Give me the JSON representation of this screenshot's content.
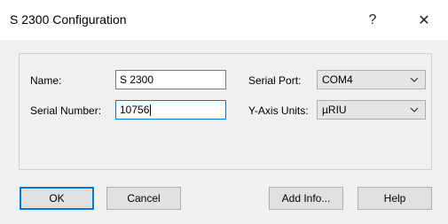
{
  "window": {
    "title": "S 2300 Configuration",
    "help_glyph": "?",
    "close_glyph": "✕"
  },
  "form": {
    "name_label": "Name:",
    "name_value": "S 2300",
    "serial_number_label": "Serial Number:",
    "serial_number_value": "10756",
    "serial_port_label": "Serial Port:",
    "serial_port_value": "COM4",
    "y_axis_units_label": "Y-Axis Units:",
    "y_axis_units_value": "µRIU"
  },
  "buttons": {
    "ok": "OK",
    "cancel": "Cancel",
    "add_info": "Add Info...",
    "help": "Help"
  },
  "colors": {
    "focus_border": "#0078d7",
    "dialog_background": "#f0f0f0",
    "titlebar_background": "#ffffff"
  },
  "icons": {
    "help": "question-mark-icon",
    "close": "close-icon",
    "dropdown": "chevron-down-icon"
  }
}
